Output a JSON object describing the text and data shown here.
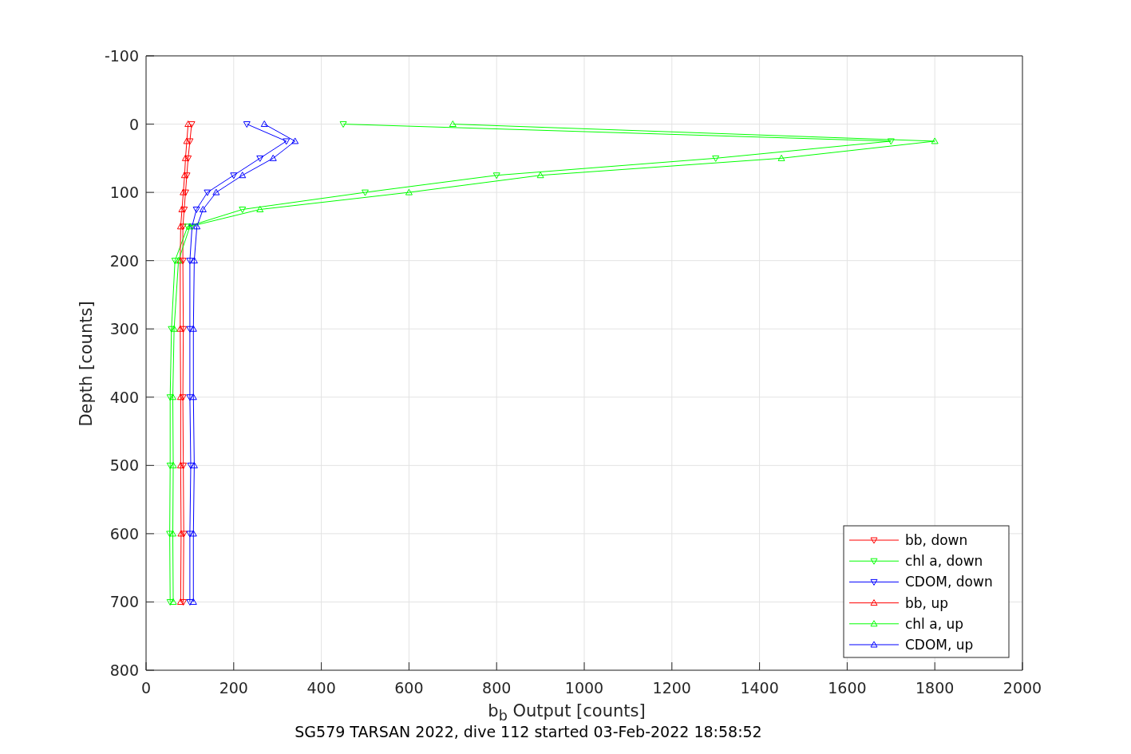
{
  "figure": {
    "title": "SG579 TARSAN 2022, dive 112 started 03-Feb-2022 18:58:52",
    "chart_data": {
      "type": "line",
      "orientation": "horizontal",
      "grid": true,
      "legend": "lower right",
      "xlabel": "b$_{b}$ Output [counts]",
      "ylabel": "Depth [counts]",
      "x": [
        0,
        25,
        50,
        75,
        100,
        125,
        150,
        200,
        300,
        400,
        500,
        600,
        700
      ],
      "xlim": [
        0,
        2000
      ],
      "ylim": [
        800,
        -100
      ],
      "xticks": [
        0,
        200,
        400,
        600,
        800,
        1000,
        1200,
        1400,
        1600,
        1800,
        2000
      ],
      "yticks": [
        -100,
        0,
        100,
        200,
        300,
        400,
        500,
        600,
        700,
        800
      ],
      "series": [
        {
          "name": "bb, down",
          "color": "#ff0000",
          "marker": "triangle",
          "values": [
            104,
            100,
            96,
            93,
            90,
            87,
            84,
            84,
            85,
            84,
            85,
            86,
            85
          ]
        },
        {
          "name": "chl a, down",
          "color": "#00ff00",
          "marker": "triangle",
          "values": [
            450,
            1700,
            1300,
            800,
            500,
            220,
            95,
            66,
            58,
            55,
            55,
            54,
            55
          ]
        },
        {
          "name": "CDOM, down",
          "color": "#0000ff",
          "marker": "triangle",
          "values": [
            230,
            320,
            260,
            200,
            140,
            115,
            105,
            100,
            100,
            100,
            102,
            100,
            100
          ]
        },
        {
          "name": "bb, up",
          "color": "#ff0000",
          "marker": "triangle",
          "values": [
            96,
            93,
            90,
            88,
            85,
            82,
            79,
            78,
            78,
            79,
            79,
            80,
            79
          ]
        },
        {
          "name": "chl a, up",
          "color": "#00ff00",
          "marker": "triangle",
          "values": [
            700,
            1800,
            1450,
            900,
            600,
            260,
            100,
            74,
            64,
            61,
            62,
            61,
            62
          ]
        },
        {
          "name": "CDOM, up",
          "color": "#0000ff",
          "marker": "triangle",
          "values": [
            270,
            340,
            290,
            220,
            160,
            130,
            116,
            110,
            108,
            108,
            110,
            108,
            108
          ]
        }
      ]
    }
  }
}
